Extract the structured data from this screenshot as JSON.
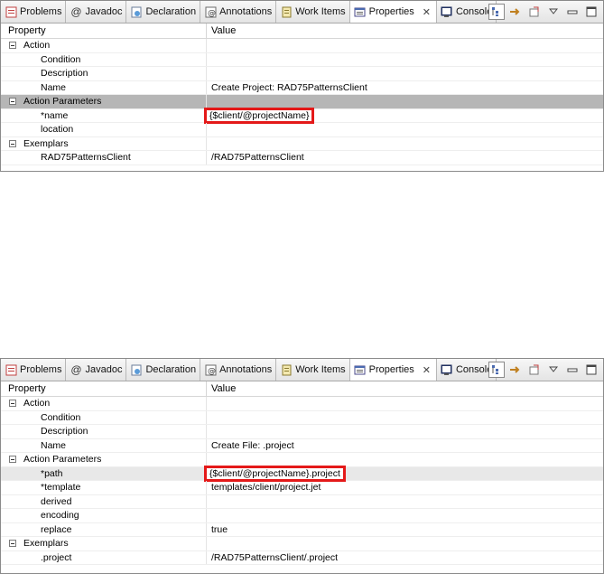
{
  "colors": {
    "highlight": "#e41919",
    "selected_row": "#b6b6b6"
  },
  "tabs": [
    {
      "label": "Problems",
      "icon": "problems-icon"
    },
    {
      "label": "Javadoc",
      "icon": "javadoc-icon"
    },
    {
      "label": "Declaration",
      "icon": "declaration-icon"
    },
    {
      "label": "Annotations",
      "icon": "annotations-icon"
    },
    {
      "label": "Work Items",
      "icon": "work-items-icon"
    },
    {
      "label": "Properties",
      "icon": "properties-icon",
      "active": true
    },
    {
      "label": "Console",
      "icon": "console-icon"
    }
  ],
  "table_header": {
    "property": "Property",
    "value": "Value"
  },
  "panel1": {
    "rows": [
      {
        "kind": "category",
        "property": "Action",
        "value": ""
      },
      {
        "kind": "child",
        "property": "Condition",
        "value": ""
      },
      {
        "kind": "child",
        "property": "Description",
        "value": ""
      },
      {
        "kind": "child",
        "property": "Name",
        "value": "Create Project: RAD75PatternsClient"
      },
      {
        "kind": "category",
        "property": "Action Parameters",
        "value": "",
        "selected": true
      },
      {
        "kind": "child",
        "property": "*name",
        "value": "{$client/@projectName}",
        "highlight": true
      },
      {
        "kind": "child",
        "property": "location",
        "value": ""
      },
      {
        "kind": "category",
        "property": "Exemplars",
        "value": ""
      },
      {
        "kind": "child",
        "property": "RAD75PatternsClient",
        "value": "/RAD75PatternsClient"
      }
    ]
  },
  "panel2": {
    "rows": [
      {
        "kind": "category",
        "property": "Action",
        "value": ""
      },
      {
        "kind": "child",
        "property": "Condition",
        "value": ""
      },
      {
        "kind": "child",
        "property": "Description",
        "value": ""
      },
      {
        "kind": "child",
        "property": "Name",
        "value": "Create File: .project"
      },
      {
        "kind": "category",
        "property": "Action Parameters",
        "value": ""
      },
      {
        "kind": "child",
        "property": "*path",
        "value": "{$client/@projectName}.project",
        "highlight": true,
        "light": true
      },
      {
        "kind": "child",
        "property": "*template",
        "value": "templates/client/project.jet"
      },
      {
        "kind": "child",
        "property": "derived",
        "value": ""
      },
      {
        "kind": "child",
        "property": "encoding",
        "value": ""
      },
      {
        "kind": "child",
        "property": "replace",
        "value": "true"
      },
      {
        "kind": "category",
        "property": "Exemplars",
        "value": ""
      },
      {
        "kind": "child",
        "property": ".project",
        "value": "/RAD75PatternsClient/.project"
      }
    ]
  }
}
